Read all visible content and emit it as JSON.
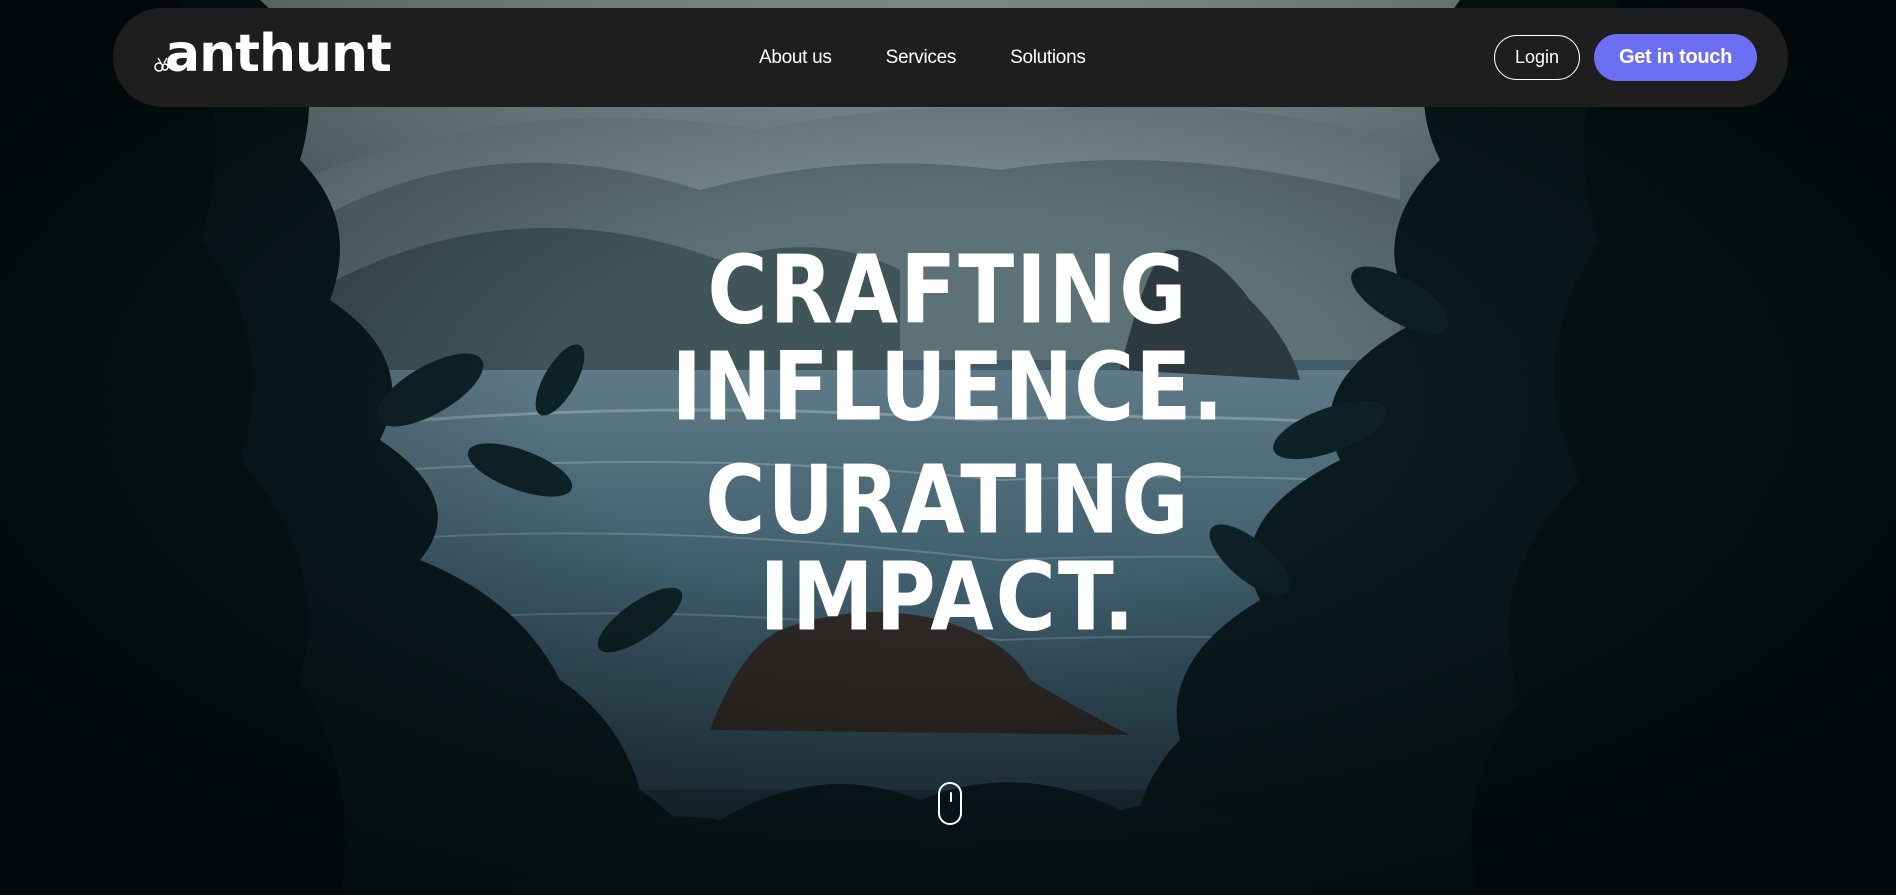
{
  "brand": {
    "name": "anthunt",
    "logo_icon": "ant-icon"
  },
  "nav": {
    "links": [
      {
        "label": "About us"
      },
      {
        "label": "Services"
      },
      {
        "label": "Solutions"
      }
    ],
    "login_label": "Login",
    "cta_label": "Get in touch"
  },
  "hero": {
    "line1": "Crafting",
    "line2": "Influence.",
    "line3": "Curating",
    "line4": "Impact.",
    "scroll_icon": "mouse-scroll-icon"
  },
  "colors": {
    "nav_background": "#1e1e1e",
    "accent": "#6c6ff2",
    "text": "#ffffff"
  }
}
